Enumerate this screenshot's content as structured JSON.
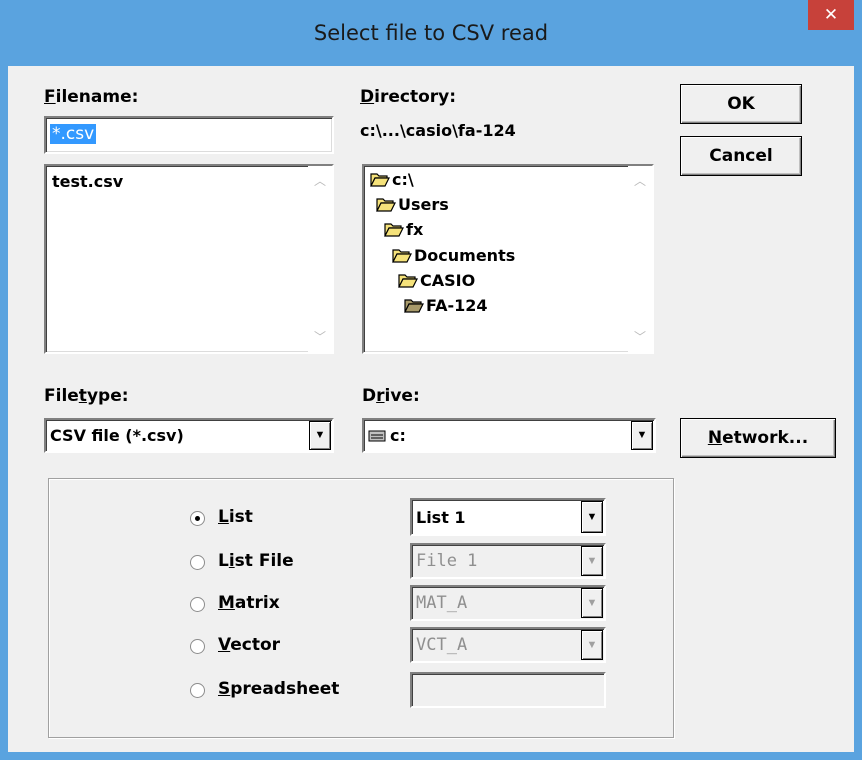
{
  "window": {
    "title": "Select file to CSV read",
    "close_glyph": "✕"
  },
  "filename": {
    "label_u": "F",
    "label_rest": "ilename:",
    "value": "*.csv",
    "files": [
      "test.csv"
    ]
  },
  "directory": {
    "label_u": "D",
    "label_rest": "irectory:",
    "path": "c:\\...\\casio\\fa-124",
    "tree": [
      "c:\\",
      "Users",
      "fx",
      "Documents",
      "CASIO",
      "FA-124"
    ]
  },
  "filetype": {
    "label_pre": "File",
    "label_u": "t",
    "label_rest": "ype:",
    "value": "CSV file (*.csv)"
  },
  "drive": {
    "label_pre": "D",
    "label_u": "r",
    "label_rest": "ive:",
    "value": "c:"
  },
  "buttons": {
    "ok": "OK",
    "cancel": "Cancel",
    "network_u": "N",
    "network_rest": "etwork..."
  },
  "options": {
    "list": {
      "u": "L",
      "rest": "ist",
      "value": "List 1",
      "selected": true
    },
    "listfile": {
      "pre": "L",
      "u": "i",
      "rest": "st File",
      "value": "File 1"
    },
    "matrix": {
      "u": "M",
      "rest": "atrix",
      "value": "MAT_A"
    },
    "vector": {
      "u": "V",
      "rest": "ector",
      "value": "VCT_A"
    },
    "spreadsheet": {
      "u": "S",
      "rest": "preadsheet",
      "value": ""
    }
  },
  "colors": {
    "titlebar": "#5aa3df",
    "close": "#c7413a",
    "selection": "#3399ff",
    "face": "#f0f0f0"
  }
}
